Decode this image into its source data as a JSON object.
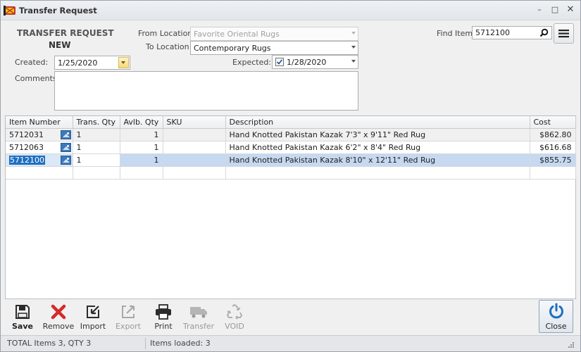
{
  "window": {
    "title": "Transfer Request"
  },
  "header": {
    "title": "TRANSFER REQUEST",
    "status": "NEW"
  },
  "form": {
    "from_location_label": "From Location",
    "from_location_value": "Favorite Oriental Rugs",
    "to_location_label": "To Location",
    "to_location_value": "Contemporary Rugs",
    "created_label": "Created:",
    "created_value": "1/25/2020",
    "expected_label": "Expected:",
    "expected_value": "1/28/2020",
    "expected_checked": true,
    "comments_label": "Comments",
    "comments_value": "",
    "find_item_label": "Find Item",
    "find_item_value": "5712100"
  },
  "grid": {
    "columns": [
      "Item Number",
      "Trans. Qty",
      "Avlb. Qty",
      "SKU",
      "Description",
      "Cost"
    ],
    "rows": [
      {
        "item": "5712031",
        "trans_qty": "1",
        "avlb_qty": "1",
        "sku": "",
        "description": "Hand Knotted Pakistan Kazak 7'3\" x 9'11\" Red Rug",
        "cost": "$862.80"
      },
      {
        "item": "5712063",
        "trans_qty": "1",
        "avlb_qty": "1",
        "sku": "",
        "description": "Hand Knotted Pakistan Kazak 6'2\" x 8'4\" Red Rug",
        "cost": "$616.68"
      },
      {
        "item": "5712100",
        "trans_qty": "1",
        "avlb_qty": "1",
        "sku": "",
        "description": "Hand Knotted Pakistan Kazak 8'10\" x 12'11\" Red Rug",
        "cost": "$855.75"
      }
    ],
    "selected_row": 2
  },
  "toolbar": {
    "save": "Save",
    "remove": "Remove",
    "import": "Import",
    "export": "Export",
    "print": "Print",
    "transfer": "Transfer",
    "void": "VOID",
    "close": "Close"
  },
  "status": {
    "totals": "TOTAL Items 3,   QTY 3",
    "loaded": "Items loaded: 3"
  },
  "colors": {
    "accent": "#1f6fc0",
    "remove_red": "#d42a2a",
    "selection": "#c6d9f0"
  }
}
